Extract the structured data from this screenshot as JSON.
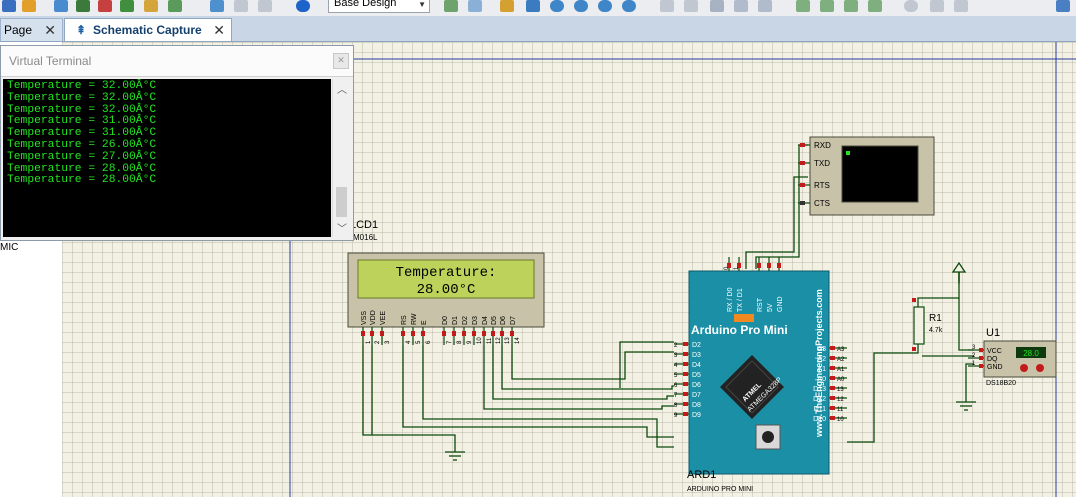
{
  "toolbar": {
    "design_select": "Base Design",
    "icons": [
      "new-sheet-icon",
      "open-icon",
      "grid-icon",
      "component-icon",
      "arrow-icon",
      "save-icon",
      "print-icon",
      "area-icon",
      "image-icon",
      "help-icon",
      "design-icon",
      "grid-toggle-icon",
      "origin-icon",
      "pan-icon",
      "zoom-in-icon",
      "zoom-out-icon",
      "zoom-all-icon",
      "zoom-area-icon",
      "undo-icon",
      "redo-icon",
      "cut-icon",
      "copy-icon",
      "paste-icon",
      "block-copy-icon",
      "block-move-icon",
      "block-rotate-icon",
      "block-delete-icon",
      "search-icon",
      "wire-autorouter-icon",
      "property-icon"
    ]
  },
  "tabs": [
    {
      "label": "Page",
      "active": false
    },
    {
      "label": "Schematic Capture",
      "active": true
    }
  ],
  "left_panel": {
    "fragment": "MIC"
  },
  "virtual_terminal": {
    "title": "Virtual Terminal",
    "lines": [
      "Temperature = 32.00Â°C",
      "Temperature = 32.00Â°C",
      "Temperature = 32.00Â°C",
      "Temperature = 31.00Â°C",
      "Temperature = 31.00Â°C",
      "Temperature = 26.00Â°C",
      "Temperature = 27.00Â°C",
      "Temperature = 28.00Â°C",
      "Temperature = 28.00Â°C"
    ]
  },
  "schematic": {
    "lcd": {
      "ref": "LCD1",
      "part": "M016L",
      "line1": "Temperature:",
      "line2": "28.00°C",
      "pins": [
        "VSS",
        "VDD",
        "VEE",
        "RS",
        "RW",
        "E",
        "D0",
        "D1",
        "D2",
        "D3",
        "D4",
        "D5",
        "D6",
        "D7"
      ],
      "pin_numbers": [
        "1",
        "2",
        "3",
        "4",
        "5",
        "6",
        "7",
        "8",
        "9",
        "10",
        "11",
        "12",
        "13",
        "14"
      ]
    },
    "terminal": {
      "pins": [
        "RXD",
        "TXD",
        "RTS",
        "CTS"
      ]
    },
    "arduino": {
      "title": "Arduino Pro Mini",
      "ref": "ARD1",
      "part": "ARDUINO PRO MINI",
      "watermark": "www.TheEngineeringProjects.com",
      "chip_line1": "ATMEL",
      "chip_line2": "ATMEGA328P",
      "top_pins": [
        "RX / D0",
        "TX / D1",
        "RST",
        "5V",
        "GND"
      ],
      "top_pin_numbers": [
        "0",
        "1"
      ],
      "left_pins": [
        "D2",
        "D3",
        "D4",
        "D5",
        "D6",
        "D7",
        "D8",
        "D9"
      ],
      "left_pin_numbers": [
        "2",
        "3",
        "4",
        "5",
        "6",
        "7",
        "8",
        "9"
      ],
      "right_pins": [
        "A3",
        "A2",
        "A1",
        "A0",
        "D13",
        "D12",
        "D11",
        "D10"
      ],
      "right_pin_numbers": [
        "A3",
        "A2",
        "A1",
        "A0",
        "13",
        "12",
        "11",
        "10"
      ]
    },
    "resistor": {
      "ref": "R1",
      "value": "4.7k"
    },
    "sensor": {
      "ref": "U1",
      "part": "DS18B20",
      "pins": [
        "VCC",
        "DQ",
        "GND"
      ],
      "pin_numbers": [
        "3",
        "2",
        "1"
      ],
      "reading": "28.0"
    },
    "colors": {
      "wire": "#0c4a0c",
      "board": "#1a8fa5",
      "lcd_screen": "#bcd25a",
      "pin": "#c41a1a",
      "sheet_bg": "#f3f1e4"
    }
  }
}
